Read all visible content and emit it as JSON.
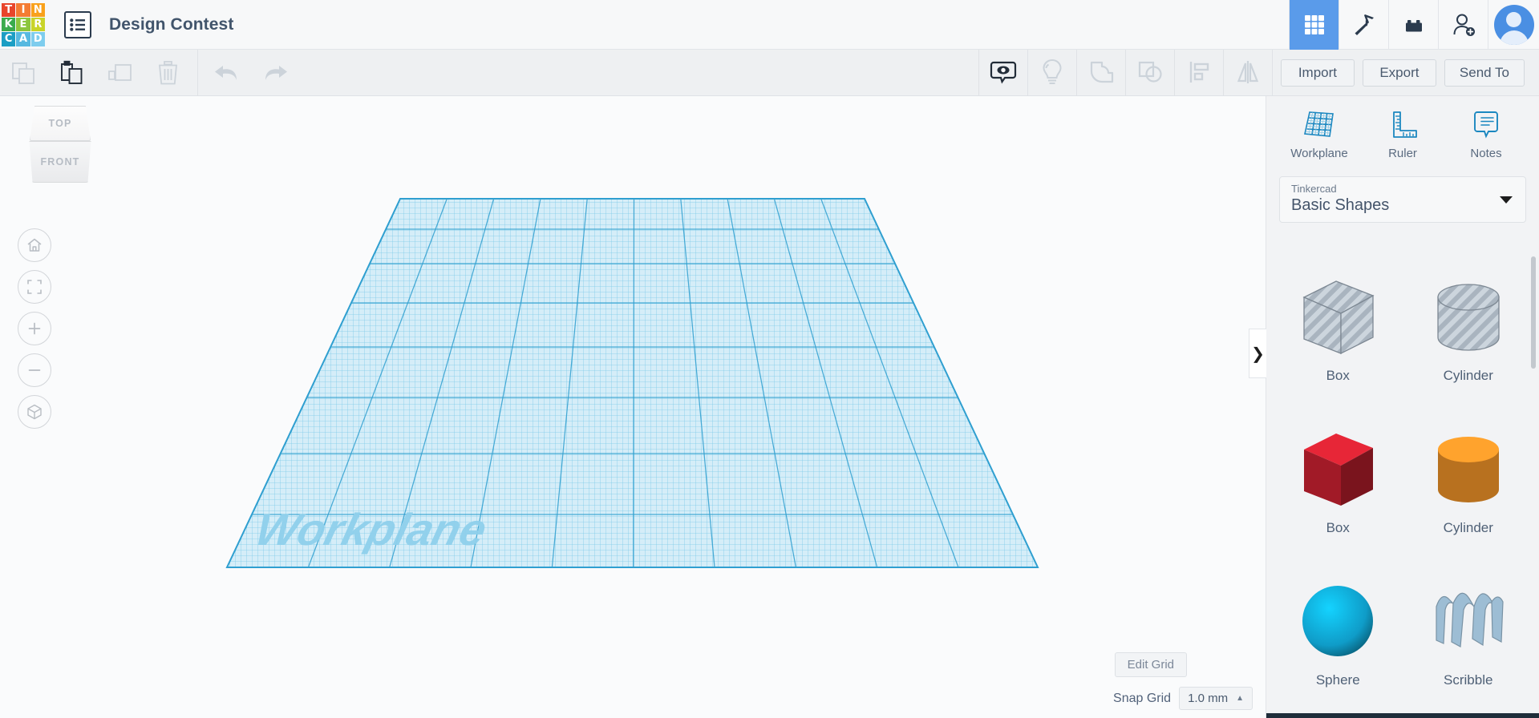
{
  "app": {
    "logo_letters": [
      {
        "ch": "T",
        "color": "#e8452c"
      },
      {
        "ch": "I",
        "color": "#f47b33"
      },
      {
        "ch": "N",
        "color": "#f9a11b"
      },
      {
        "ch": "K",
        "color": "#3aab4d"
      },
      {
        "ch": "E",
        "color": "#8cc63e"
      },
      {
        "ch": "R",
        "color": "#c9d42a"
      },
      {
        "ch": "C",
        "color": "#1b9ec4"
      },
      {
        "ch": "A",
        "color": "#57b9e0"
      },
      {
        "ch": "D",
        "color": "#7ecdee"
      }
    ],
    "document_title": "Design Contest",
    "designs_list_icon": "list-icon"
  },
  "topbar_right": {
    "items": [
      {
        "name": "grid-apps-icon",
        "label": "Apps",
        "active": true
      },
      {
        "name": "pickaxe-icon",
        "label": "Minecraft",
        "active": false
      },
      {
        "name": "lego-brick-icon",
        "label": "Blocks",
        "active": false
      },
      {
        "name": "add-person-icon",
        "label": "Invite",
        "active": false
      }
    ],
    "avatar": "user-avatar",
    "accent_color": "#5a9bea"
  },
  "toolbar": {
    "left_tools": [
      {
        "name": "copy-icon",
        "label": "Copy",
        "enabled": false
      },
      {
        "name": "paste-icon",
        "label": "Paste",
        "enabled": true
      },
      {
        "name": "duplicate-icon",
        "label": "Duplicate",
        "enabled": false
      },
      {
        "name": "delete-icon",
        "label": "Delete",
        "enabled": false
      }
    ],
    "history_tools": [
      {
        "name": "undo-icon",
        "label": "Undo",
        "enabled": false
      },
      {
        "name": "redo-icon",
        "label": "Redo",
        "enabled": false
      }
    ],
    "center_tools": [
      {
        "name": "show-hide-eye-icon",
        "label": "Show/Hide",
        "enabled": true
      },
      {
        "name": "lightbulb-icon",
        "label": "Highlight",
        "enabled": false
      },
      {
        "name": "group-shapes-icon",
        "label": "Group",
        "enabled": false
      },
      {
        "name": "ungroup-shapes-icon",
        "label": "Ungroup",
        "enabled": false
      },
      {
        "name": "align-icon",
        "label": "Align",
        "enabled": false
      },
      {
        "name": "mirror-icon",
        "label": "Mirror",
        "enabled": false
      }
    ],
    "import_label": "Import",
    "export_label": "Export",
    "send_to_label": "Send To"
  },
  "canvas": {
    "view_cube": {
      "top_label": "TOP",
      "front_label": "FRONT"
    },
    "nav_buttons": [
      {
        "name": "home-view-icon",
        "label": "Home view"
      },
      {
        "name": "fit-to-view-icon",
        "label": "Fit all in view"
      },
      {
        "name": "zoom-in-icon",
        "label": "Zoom in"
      },
      {
        "name": "zoom-out-icon",
        "label": "Zoom out"
      },
      {
        "name": "ortho-perspective-icon",
        "label": "Switch to orthographic view"
      }
    ],
    "workplane_label": "Workplane",
    "edit_grid_label": "Edit Grid",
    "snap_grid_label": "Snap Grid",
    "snap_grid_value": "1.0 mm",
    "grid_color": "#2fa8d6",
    "grid_fill": "#cdeaf6"
  },
  "right_panel": {
    "tabs": [
      {
        "name": "workplane-tab",
        "label": "Workplane",
        "icon": "workplane-grid-icon"
      },
      {
        "name": "ruler-tab",
        "label": "Ruler",
        "icon": "ruler-icon"
      },
      {
        "name": "notes-tab",
        "label": "Notes",
        "icon": "notes-bubble-icon"
      }
    ],
    "library_selector": {
      "sub_label": "Tinkercad",
      "value": "Basic Shapes"
    },
    "shapes": [
      {
        "name": "Box",
        "kind": "box",
        "style": "hole",
        "color": "#b9c2cb"
      },
      {
        "name": "Cylinder",
        "kind": "cylinder",
        "style": "hole",
        "color": "#b9c2cb"
      },
      {
        "name": "Box",
        "kind": "box",
        "style": "solid",
        "color": "#c4202f"
      },
      {
        "name": "Cylinder",
        "kind": "cylinder",
        "style": "solid",
        "color": "#e08a26"
      },
      {
        "name": "Sphere",
        "kind": "sphere",
        "style": "solid",
        "color": "#0f9cc8"
      },
      {
        "name": "Scribble",
        "kind": "scribble",
        "style": "solid",
        "color": "#9dbdd4"
      }
    ],
    "collapse_icon": "chevron-right-icon",
    "panel_accent": "#1b87c0"
  }
}
